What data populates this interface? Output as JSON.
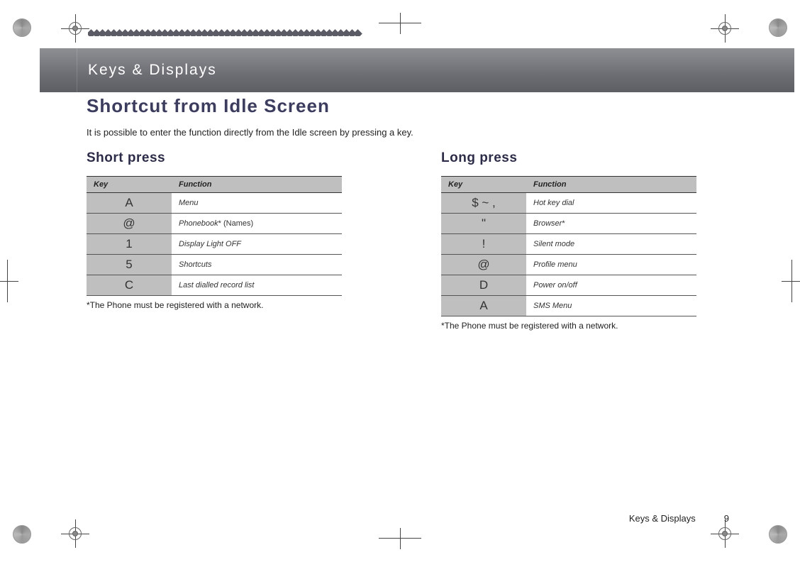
{
  "header": {
    "chapter": "Keys & Displays"
  },
  "section": {
    "title": "Shortcut from Idle Screen",
    "intro": "It is possible to enter the function directly from the Idle screen by pressing a key."
  },
  "columns": {
    "left": {
      "heading": "Short press",
      "th_key": "Key",
      "th_fn": "Function",
      "rows": [
        {
          "key": "A",
          "fn_italic": "Menu",
          "fn_plain": ""
        },
        {
          "key": "@",
          "fn_italic": "Phonebook",
          "fn_plain": "* (Names)"
        },
        {
          "key": "1",
          "fn_italic": "Display Light OFF",
          "fn_plain": ""
        },
        {
          "key": "5",
          "fn_italic": "Shortcuts",
          "fn_plain": ""
        },
        {
          "key": "C",
          "fn_italic": "Last dialled record list",
          "fn_plain": ""
        }
      ],
      "footnote": "*The Phone must be registered with a network."
    },
    "right": {
      "heading": "Long press",
      "th_key": "Key",
      "th_fn": "Function",
      "rows": [
        {
          "key": "$   ~ ,",
          "fn_italic": "Hot key dial",
          "fn_plain": ""
        },
        {
          "key": "\"",
          "fn_italic": "Browser",
          "fn_plain": "*"
        },
        {
          "key": "!",
          "fn_italic": "Silent mode",
          "fn_plain": ""
        },
        {
          "key": "@",
          "fn_italic": "Profile menu",
          "fn_plain": ""
        },
        {
          "key": "D",
          "fn_italic": "Power on/off",
          "fn_plain": ""
        },
        {
          "key": "A",
          "fn_italic": "SMS Menu",
          "fn_plain": ""
        }
      ],
      "footnote": "*The Phone must be registered with a network."
    }
  },
  "footer": {
    "chapter": "Keys & Displays",
    "page": "9"
  }
}
